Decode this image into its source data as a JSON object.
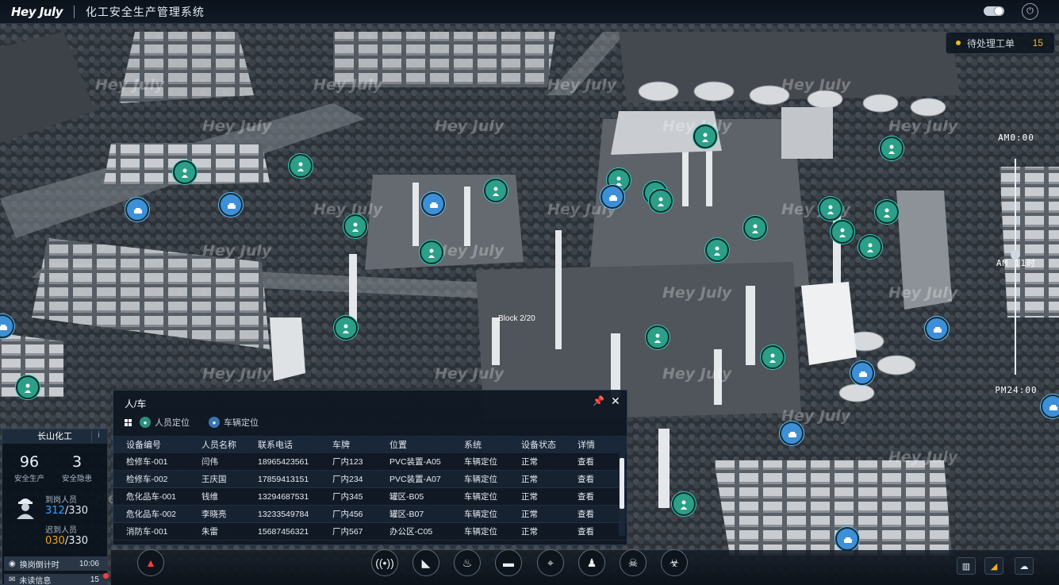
{
  "header": {
    "logo": "Hey July",
    "title": "化工安全生产管理系统"
  },
  "pending": {
    "label": "待处理工单",
    "count": "15"
  },
  "timeline": {
    "top": "AM0:00",
    "mid": "AM 11时",
    "bottom": "PM24:00"
  },
  "watermark": "Hey July",
  "map_label": "Block 2/20",
  "panel": {
    "title": "人/车",
    "tabs": [
      "人员定位",
      "车辆定位"
    ],
    "columns": [
      "设备编号",
      "人员名称",
      "联系电话",
      "车牌",
      "位置",
      "系统",
      "设备状态",
      "详情"
    ],
    "rows": [
      [
        "检修车-001",
        "闫伟",
        "18965423561",
        "厂内123",
        "PVC装置-A05",
        "车辆定位",
        "正常",
        "查看"
      ],
      [
        "检修车-002",
        "王庆国",
        "17859413151",
        "厂内234",
        "PVC装置-A07",
        "车辆定位",
        "正常",
        "查看"
      ],
      [
        "危化品车-001",
        "钱维",
        "13294687531",
        "厂内345",
        "罐区-B05",
        "车辆定位",
        "正常",
        "查看"
      ],
      [
        "危化品车-002",
        "李晓亮",
        "13233549784",
        "厂内456",
        "罐区-B07",
        "车辆定位",
        "正常",
        "查看"
      ],
      [
        "消防车-001",
        "朱雷",
        "15687456321",
        "厂内567",
        "办公区-C05",
        "车辆定位",
        "正常",
        "查看"
      ]
    ]
  },
  "left": {
    "company": "长山化工",
    "info_icon": "i",
    "production": {
      "value": "96",
      "label": "安全生产"
    },
    "hazard": {
      "value": "3",
      "label": "安全隐患"
    },
    "arrived": {
      "label": "到岗人员",
      "current": "312",
      "total": "/330"
    },
    "late": {
      "label": "迟到人员",
      "current": "030",
      "total": "/330"
    },
    "countdown": {
      "label": "换岗倒计时",
      "value": "10:06"
    },
    "unread": {
      "label": "未读信息",
      "value": "15"
    }
  },
  "tools": [
    "alarm-icon",
    "broadcast-icon",
    "camera-icon",
    "fire-icon",
    "truck-icon",
    "satellite-icon",
    "person-icon",
    "skull-icon",
    "biohazard-icon"
  ],
  "colors": {
    "accent": "#3aa0ff",
    "warning": "#f0a020",
    "person_marker": "#2b9f88",
    "vehicle_marker": "#3d8fd8"
  }
}
